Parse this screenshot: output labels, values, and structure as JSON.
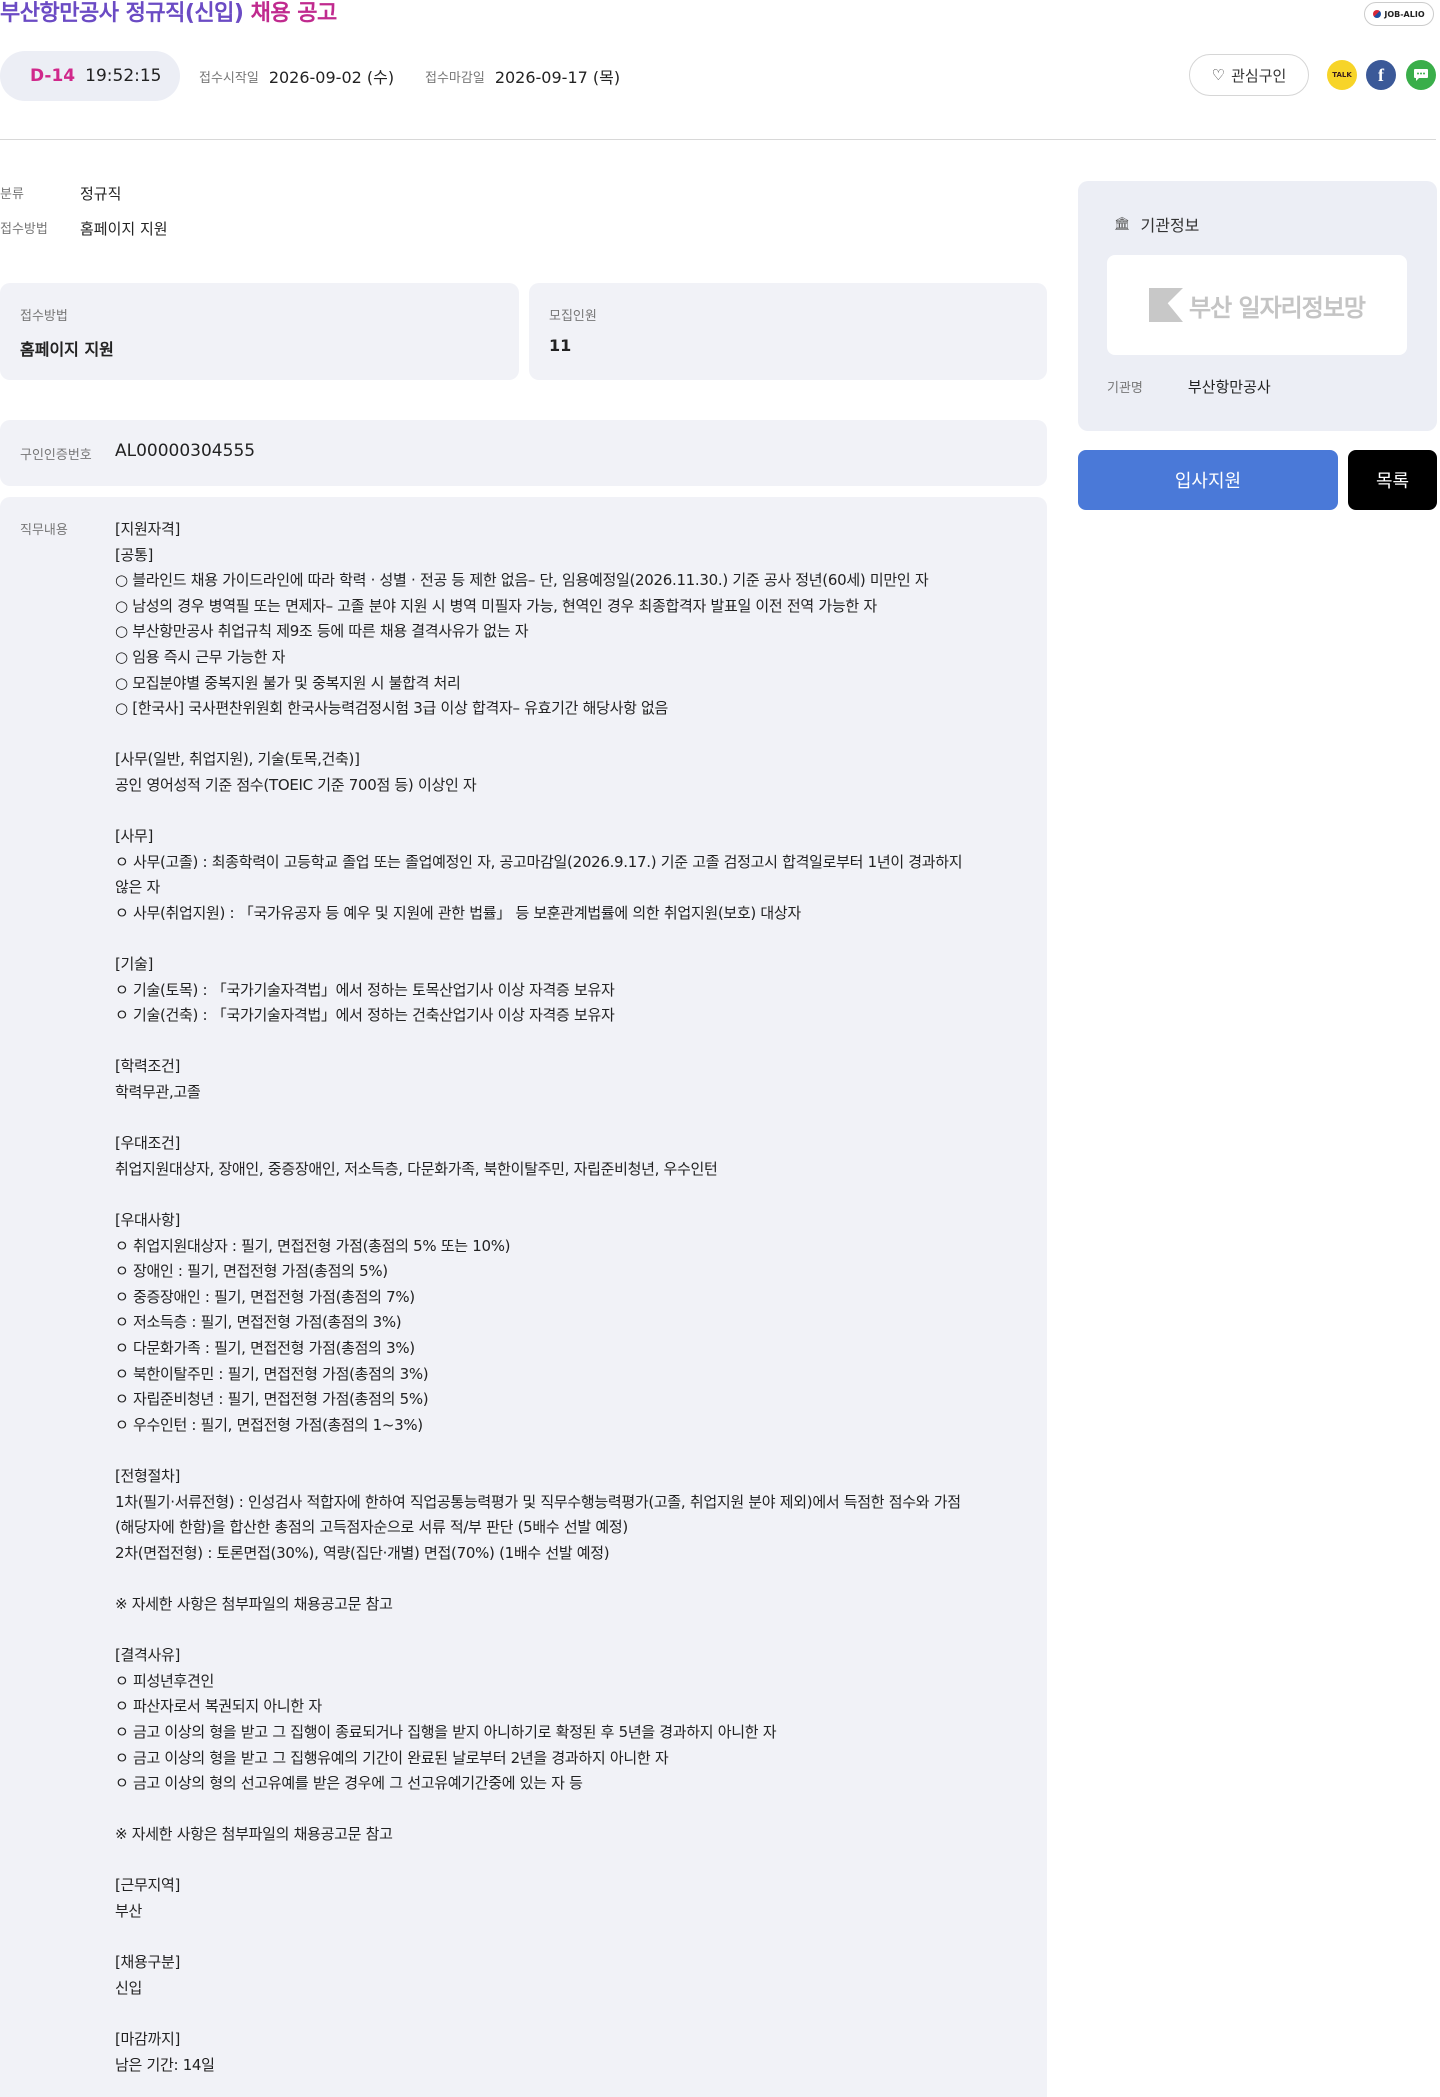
{
  "header": {
    "title_org": "부산항만공사 정규직(신입)",
    "title_suffix": "채용 공고",
    "badge": "JOB-ALIO"
  },
  "status": {
    "dday": "D-14",
    "countdown": "19:52:15",
    "start_label": "접수시작일",
    "start_date": "2026-09-02 (수)",
    "end_label": "접수마감일",
    "end_date": "2026-09-17 (목)",
    "favorite_label": "관심구인"
  },
  "share": {
    "kakao": "TALK",
    "facebook": "f",
    "sms": "SMS"
  },
  "summary": {
    "category_label": "분류",
    "category_value": "정규직",
    "method_label": "접수방법",
    "method_value": "홈페이지 지원"
  },
  "cards": {
    "method_label": "접수방법",
    "method_value": "홈페이지 지원",
    "recruit_label": "모집인원",
    "recruit_value": "11"
  },
  "cert": {
    "label": "구인인증번호",
    "value": "AL00000304555"
  },
  "duty": {
    "label": "직무내용",
    "lines": [
      "[지원자격]",
      "[공통]",
      "○ 블라인드 채용 가이드라인에 따라 학력 · 성별 · 전공 등 제한 없음– 단, 임용예정일(2026.11.30.) 기준 공사 정년(60세) 미만인 자",
      "○ 남성의 경우 병역필 또는 면제자– 고졸 분야 지원 시 병역 미필자 가능, 현역인 경우 최종합격자 발표일 이전 전역 가능한 자",
      "○ 부산항만공사 취업규칙 제9조 등에 따른 채용 결격사유가 없는 자",
      "○ 임용 즉시 근무 가능한 자",
      "○ 모집분야별 중복지원 불가 및 중복지원 시 불합격 처리",
      "○ [한국사] 국사편찬위원회 한국사능력검정시험 3급 이상 합격자– 유효기간 해당사항 없음",
      "",
      "[사무(일반, 취업지원), 기술(토목,건축)]",
      "공인 영어성적 기준 점수(TOEIC 기준 700점 등) 이상인 자",
      "",
      "[사무]",
      "ㅇ 사무(고졸) : 최종학력이 고등학교 졸업 또는 졸업예정인 자, 공고마감일(2026.9.17.) 기준 고졸 검정고시 합격일로부터 1년이 경과하지",
      "않은 자",
      "ㅇ 사무(취업지원) : 「국가유공자 등 예우 및 지원에 관한 법률」 등 보훈관계법률에 의한 취업지원(보호) 대상자",
      "",
      "[기술]",
      "ㅇ 기술(토목) : 「국가기술자격법」에서 정하는 토목산업기사 이상 자격증 보유자",
      "ㅇ 기술(건축) : 「국가기술자격법」에서 정하는 건축산업기사 이상 자격증 보유자",
      "",
      "[학력조건]",
      "학력무관,고졸",
      "",
      "[우대조건]",
      "취업지원대상자, 장애인, 중증장애인, 저소득층, 다문화가족, 북한이탈주민, 자립준비청년, 우수인턴",
      "",
      "[우대사항]",
      "ㅇ 취업지원대상자 : 필기, 면접전형 가점(총점의 5% 또는 10%)",
      "ㅇ 장애인 : 필기, 면접전형 가점(총점의 5%)",
      "ㅇ 중증장애인 : 필기, 면접전형 가점(총점의 7%)",
      "ㅇ 저소득층 : 필기, 면접전형 가점(총점의 3%)",
      "ㅇ 다문화가족 : 필기, 면접전형 가점(총점의 3%)",
      "ㅇ 북한이탈주민 : 필기, 면접전형 가점(총점의 3%)",
      "ㅇ 자립준비청년 : 필기, 면접전형 가점(총점의 5%)",
      "ㅇ 우수인턴 : 필기, 면접전형 가점(총점의 1~3%)",
      "",
      "[전형절차]",
      "1차(필기·서류전형) : 인성검사 적합자에 한하여 직업공통능력평가 및 직무수행능력평가(고졸, 취업지원 분야 제외)에서 득점한 점수와 가점",
      "(해당자에 한함)을 합산한 총점의 고득점자순으로 서류 적/부 판단 (5배수 선발 예정)",
      "2차(면접전형) : 토론면접(30%), 역량(집단·개별) 면접(70%) (1배수 선발 예정)",
      "",
      "※ 자세한 사항은 첨부파일의 채용공고문 참고",
      "",
      "[결격사유]",
      "ㅇ 피성년후견인",
      "ㅇ 파산자로서 복권되지 아니한 자",
      "ㅇ 금고 이상의 형을 받고 그 집행이 종료되거나 집행을 받지 아니하기로 확정된 후 5년을 경과하지 아니한 자",
      "ㅇ 금고 이상의 형을 받고 그 집행유예의 기간이 완료된 날로부터 2년을 경과하지 아니한 자",
      "ㅇ 금고 이상의 형의 선고유예를 받은 경우에 그 선고유예기간중에 있는 자 등",
      "",
      "※ 자세한 사항은 첨부파일의 채용공고문 참고",
      "",
      "[근무지역]",
      "부산",
      "",
      "[채용구분]",
      "신입",
      "",
      "[마감까지]",
      "남은 기간: 14일"
    ]
  },
  "sidebar": {
    "header_label": "기관정보",
    "logo_text": "부산 일자리정보망",
    "org_label": "기관명",
    "org_value": "부산항만공사",
    "apply_label": "입사지원",
    "list_label": "목록"
  },
  "colors": {
    "title_purple": "#6b4bc4",
    "title_magenta": "#c02a8e",
    "dday_pink": "#d0288b",
    "apply_blue": "#4a79d8",
    "panel_gray": "#f1f2f7"
  }
}
